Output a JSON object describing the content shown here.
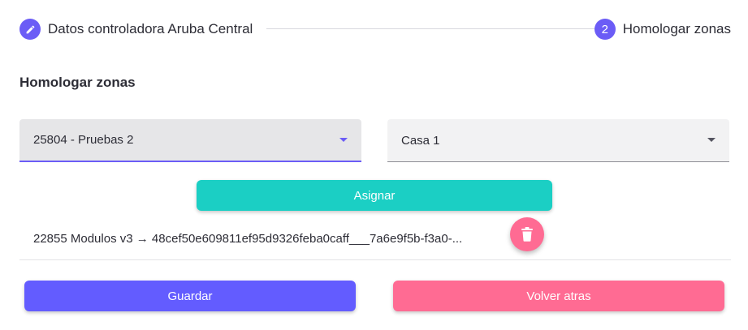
{
  "stepper": {
    "step1": {
      "icon": "pencil-icon",
      "label": "Datos controladora Aruba Central"
    },
    "step2": {
      "number": "2",
      "label": "Homologar zonas"
    }
  },
  "section_title": "Homologar zonas",
  "selects": {
    "left": {
      "value": "25804 - Pruebas 2"
    },
    "right": {
      "value": "Casa 1"
    }
  },
  "assign_button": {
    "label": "Asignar"
  },
  "mappings": [
    {
      "text": "22855 Modulos v3 → 48cef50e609811ef95d9326feba0caff___7a6e9f5b-f3a0-..."
    }
  ],
  "delete_button": {
    "icon": "trash-icon"
  },
  "footer": {
    "save_label": "Guardar",
    "back_label": "Volver atras"
  },
  "colors": {
    "primary": "#6b5cf6",
    "teal": "#1bcfc4",
    "pink": "#ff6b93",
    "save": "#635cff"
  }
}
